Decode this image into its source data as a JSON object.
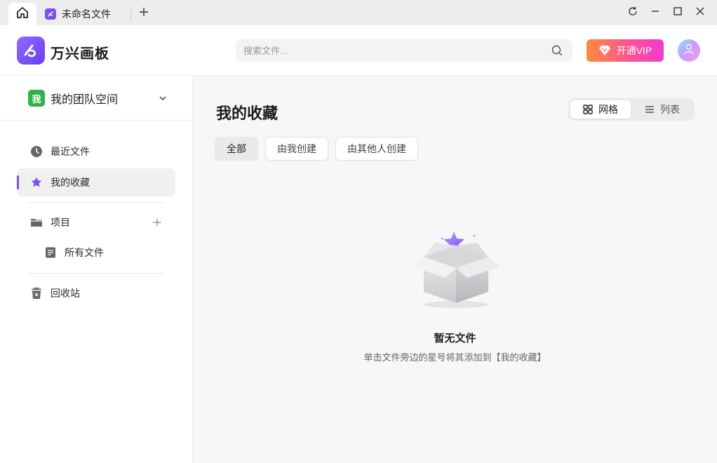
{
  "tabs": {
    "home_icon": "home-icon",
    "doc_tab_label": "未命名文件",
    "new_tab_icon": "plus-icon"
  },
  "window_controls": [
    "refresh-icon",
    "minimize-icon",
    "maximize-icon",
    "close-icon"
  ],
  "header": {
    "app_name": "万兴画板",
    "search_placeholder": "搜索文件...",
    "vip_label": "开通VIP",
    "brand_color": "#7b4ff0"
  },
  "sidebar": {
    "team_badge": "我",
    "team_name": "我的团队空间",
    "items": [
      {
        "label": "最近文件",
        "icon": "clock-icon"
      },
      {
        "label": "我的收藏",
        "icon": "star-icon",
        "active": true
      },
      {
        "label": "项目",
        "icon": "folder-icon"
      },
      {
        "label": "所有文件",
        "icon": "document-icon"
      },
      {
        "label": "回收站",
        "icon": "trash-icon"
      }
    ]
  },
  "main": {
    "title": "我的收藏",
    "view_options": [
      "网格",
      "列表"
    ],
    "selected_view": "网格",
    "filters": [
      "全部",
      "由我创建",
      "由其他人创建"
    ],
    "selected_filter": "全部",
    "empty_title": "暂无文件",
    "empty_desc": "单击文件旁边的星号将其添加到【我的收藏】"
  }
}
